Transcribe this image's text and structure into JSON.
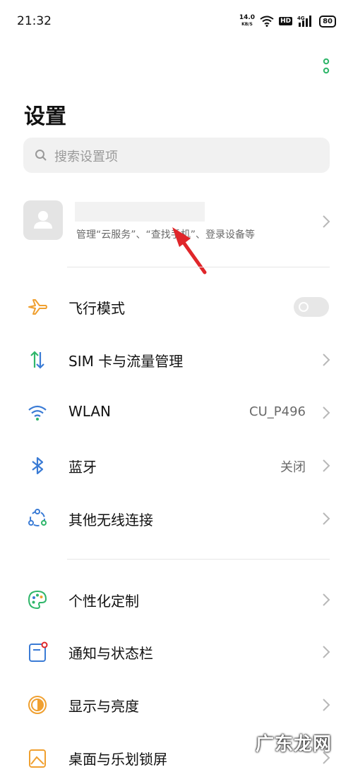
{
  "status_bar": {
    "time": "21:32",
    "net_speed": "14.0",
    "net_speed_unit": "KB/S",
    "hd": "HD",
    "network": "4G",
    "battery": "80"
  },
  "page": {
    "title": "设置"
  },
  "search": {
    "placeholder": "搜索设置项"
  },
  "account": {
    "subtitle": "管理“云服务”、“查找手机”、登录设备等"
  },
  "rows": [
    {
      "label": "飞行模式",
      "icon": "airplane-icon",
      "toggle": "off"
    },
    {
      "label": "SIM 卡与流量管理",
      "icon": "sim-data-icon"
    },
    {
      "label": "WLAN",
      "value": "CU_P496",
      "icon": "wifi-icon"
    },
    {
      "label": "蓝牙",
      "value": "关闭",
      "icon": "bluetooth-icon"
    },
    {
      "label": "其他无线连接",
      "icon": "other-wireless-icon"
    },
    {
      "label": "个性化定制",
      "icon": "palette-icon"
    },
    {
      "label": "通知与状态栏",
      "icon": "notification-icon"
    },
    {
      "label": "显示与亮度",
      "icon": "brightness-icon"
    },
    {
      "label": "桌面与乐划锁屏",
      "icon": "wallpaper-icon"
    }
  ],
  "watermark": "广东龙网",
  "colors": {
    "accent_green": "#2fb66a",
    "arrow_red": "#e0262a",
    "row_icon_blue": "#3a7bd5",
    "airplane_orange": "#f0a030"
  }
}
